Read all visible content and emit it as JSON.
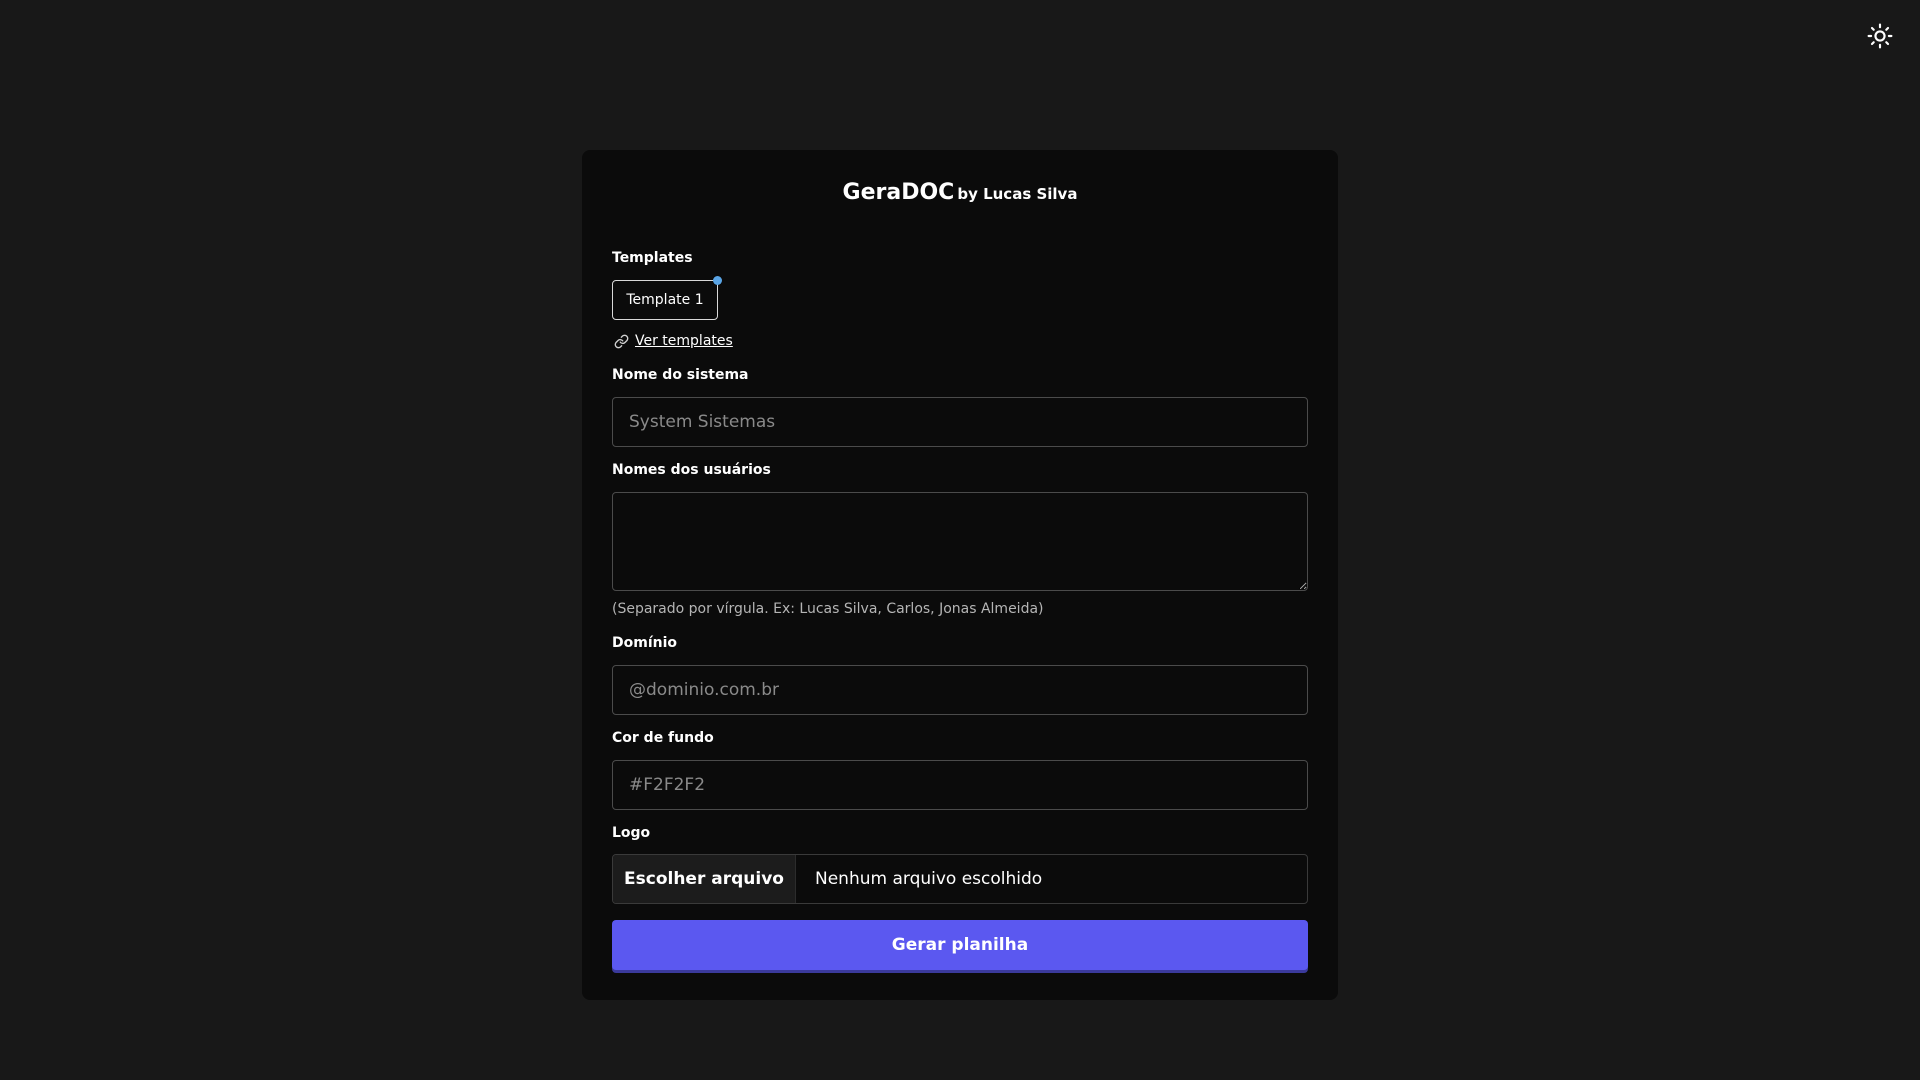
{
  "theme_toggle": {
    "icon": "sun-icon"
  },
  "header": {
    "title": "GeraDOC",
    "subtitle": "by Lucas Silva"
  },
  "templates": {
    "label": "Templates",
    "items": [
      {
        "label": "Template 1",
        "selected": true
      }
    ],
    "indicator_color": "#5aa5e6",
    "link_label": "Ver templates",
    "link_icon": "link-icon"
  },
  "system_name": {
    "label": "Nome do sistema",
    "value": "",
    "placeholder": "System Sistemas"
  },
  "users": {
    "label": "Nomes dos usuários",
    "value": "",
    "hint": "(Separado por vírgula. Ex: Lucas Silva, Carlos, Jonas Almeida)"
  },
  "domain": {
    "label": "Domínio",
    "value": "",
    "placeholder": "@dominio.com.br"
  },
  "background_color": {
    "label": "Cor de fundo",
    "value": "",
    "placeholder": "#F2F2F2"
  },
  "logo": {
    "label": "Logo",
    "button_label": "Escolher arquivo",
    "status": "Nenhum arquivo escolhido"
  },
  "submit": {
    "label": "Gerar planilha",
    "color": "#5b58f0"
  }
}
